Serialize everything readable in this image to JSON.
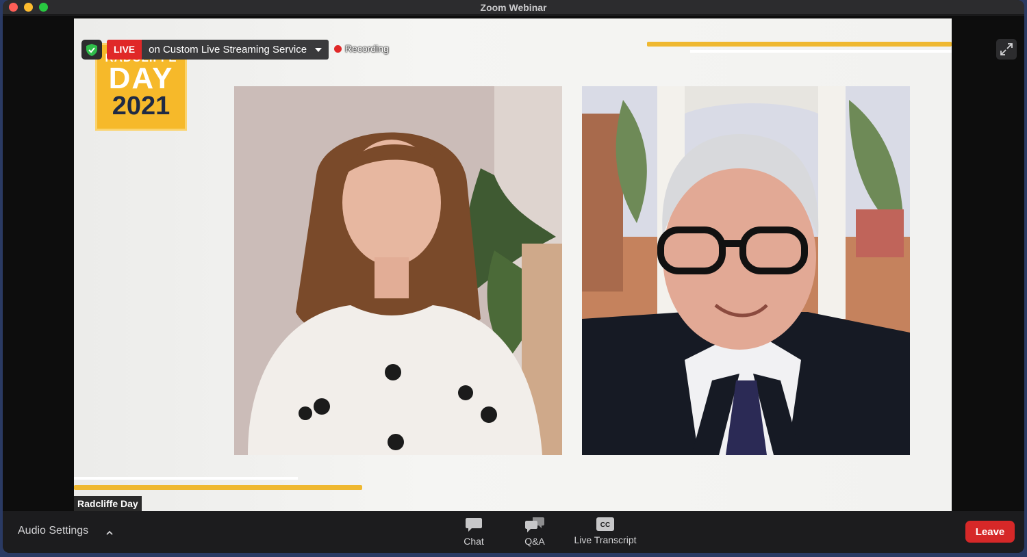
{
  "window": {
    "title": "Zoom Webinar"
  },
  "stream": {
    "live_label": "LIVE",
    "service_label": "on Custom Live Streaming Service",
    "recording_label": "Recording"
  },
  "slide": {
    "logo_line1": "RADCLIFFE",
    "logo_line2": "DAY",
    "logo_year": "2021"
  },
  "speaker": {
    "name_label": "Radcliffe Day"
  },
  "toolbar": {
    "audio_settings": "Audio Settings",
    "chat": "Chat",
    "qa": "Q&A",
    "transcript": "Live Transcript",
    "transcript_icon_text": "CC",
    "leave": "Leave"
  },
  "colors": {
    "accent_gold": "#efb830",
    "live_red": "#e02828",
    "leave_red": "#d62828",
    "secure_green": "#2fbd4a"
  },
  "icons": [
    "shield-check-icon",
    "chevron-down-icon",
    "recording-dot-icon",
    "expand-icon",
    "chevron-up-icon",
    "chat-icon",
    "qa-icon",
    "closed-caption-icon"
  ]
}
